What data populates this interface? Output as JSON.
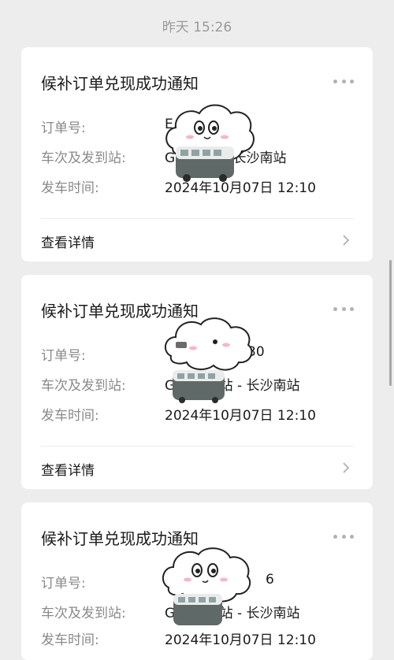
{
  "timestamp": "昨天 15:26",
  "cards": [
    {
      "title": "候补订单兑现成功通知",
      "order_label": "订单号:",
      "order_value": "E",
      "train_label": "车次及发到站:",
      "train_value": "G      阳东站 - 长沙南站",
      "depart_label": "发车时间:",
      "depart_value": "2024年10月07日 12:10",
      "detail_label": "查看详情"
    },
    {
      "title": "候补订单兑现成功通知",
      "order_label": "订单号:",
      "order_value": "30",
      "train_label": "车次及发到站:",
      "train_value": "G      安阳东站 - 长沙南站",
      "depart_label": "发车时间:",
      "depart_value": "2024年10月07日 12:10",
      "detail_label": "查看详情"
    },
    {
      "title": "候补订单兑现成功通知",
      "order_label": "订单号:",
      "order_value": "6",
      "train_label": "车次及发到站:",
      "train_value": "G      安阳东站 - 长沙南站",
      "depart_label": "发车时间:",
      "depart_value": "2024年10月07日 12:10"
    }
  ],
  "colors": {
    "background": "#ededed",
    "card": "#ffffff",
    "title_text": "#1a1a1a",
    "label_text": "#8a8a8a",
    "secondary_text": "#9a9a9a"
  }
}
